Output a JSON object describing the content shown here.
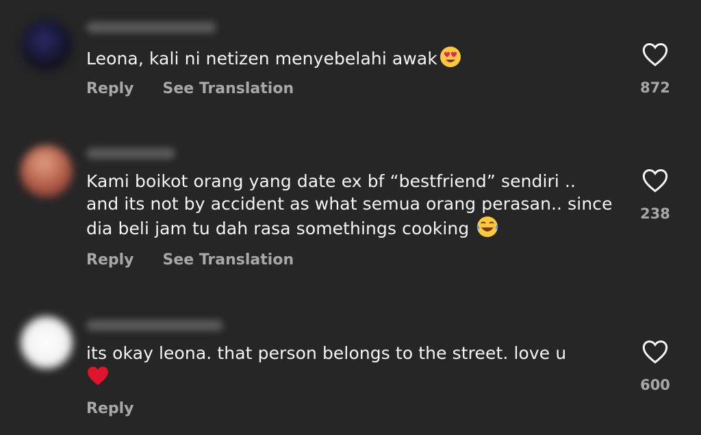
{
  "colors": {
    "background": "#262626",
    "text": "#f5f5f5",
    "muted": "#a8a8a8"
  },
  "comments": [
    {
      "text": "Leona, kali ni netizen menyebelahi awak",
      "emoji_icon": "heart-eyes-emoji-icon",
      "reply_label": "Reply",
      "translate_label": "See Translation",
      "likes": "872",
      "avatar_color": "#1c1c3a"
    },
    {
      "text": "Kami boikot orang yang date ex bf “bestfriend” sendiri .. and its not by accident as what semua orang perasan.. since dia beli jam tu dah rasa somethings cooking",
      "emoji_icon": "tears-of-joy-emoji-icon",
      "reply_label": "Reply",
      "translate_label": "See Translation",
      "likes": "238",
      "avatar_color": "#a85a48"
    },
    {
      "text": "its okay leona. that person belongs to the street. love u",
      "emoji_icon": "red-heart-emoji-icon",
      "reply_label": "Reply",
      "likes": "600",
      "avatar_color": "#f2f2f2"
    }
  ]
}
